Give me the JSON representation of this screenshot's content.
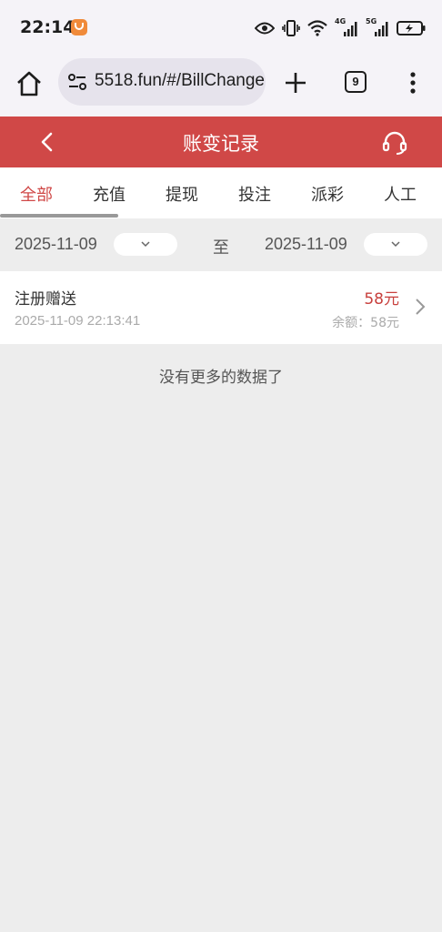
{
  "status_bar": {
    "time": "22:14",
    "network_labels": [
      "4G",
      "5G"
    ]
  },
  "browser": {
    "url": "5518.fun/#/BillChange",
    "tab_count": "9"
  },
  "header": {
    "title": "账变记录"
  },
  "tabs": [
    {
      "label": "全部",
      "active": true
    },
    {
      "label": "充值",
      "active": false
    },
    {
      "label": "提现",
      "active": false
    },
    {
      "label": "投注",
      "active": false
    },
    {
      "label": "派彩",
      "active": false
    },
    {
      "label": "人工",
      "active": false
    }
  ],
  "filter": {
    "start_date": "2025-11-09",
    "separator": "至",
    "end_date": "2025-11-09"
  },
  "records": [
    {
      "title": "注册赠送",
      "time": "2025-11-09 22:13:41",
      "amount": "58元",
      "balance": "余额：58元"
    }
  ],
  "footer_text": "没有更多的数据了",
  "colors": {
    "accent": "#d04847",
    "amount": "#c8403d",
    "background": "#ededed"
  }
}
